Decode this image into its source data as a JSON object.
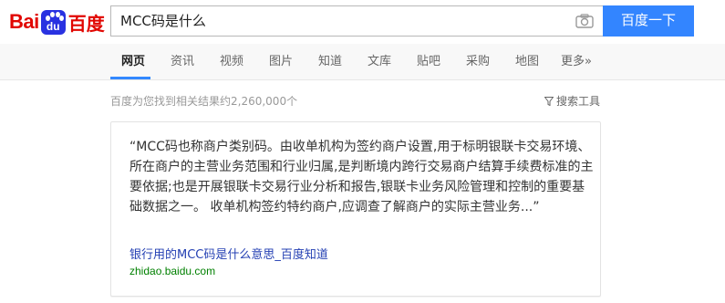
{
  "logo": {
    "part1": "Bai",
    "part2": "du",
    "part3": "百度"
  },
  "search": {
    "query": "MCC码是什么",
    "button_label": "百度一下"
  },
  "nav": {
    "items": [
      {
        "label": "网页",
        "active": true
      },
      {
        "label": "资讯"
      },
      {
        "label": "视频"
      },
      {
        "label": "图片"
      },
      {
        "label": "知道"
      },
      {
        "label": "文库"
      },
      {
        "label": "贴吧"
      },
      {
        "label": "采购"
      },
      {
        "label": "地图"
      },
      {
        "label": "更多»"
      }
    ]
  },
  "results": {
    "stats": "百度为您找到相关结果约2,260,000个",
    "tools_label": "搜索工具"
  },
  "answer_card": {
    "text": "“MCC码也称商户类别码。由收单机构为签约商户设置,用于标明银联卡交易环境、所在商户的主营业务范围和行业归属,是判断境内跨行交易商户结算手续费标准的主要依据;也是开展银联卡交易行业分析和报告,银联卡业务风险管理和控制的重要基础数据之一。 收单机构签约特约商户,应调查了解商户的实际主营业务...”",
    "link_title": "银行用的MCC码是什么意思_百度知道",
    "url": "zhidao.baidu.com"
  },
  "colors": {
    "accent": "#3385ff",
    "brand_red": "#e10601",
    "brand_blue": "#2932e1",
    "link": "#2440b3",
    "url": "#008000"
  },
  "icons": {
    "camera": "camera-icon",
    "funnel": "funnel-icon",
    "paw": "baidu-paw-icon"
  }
}
